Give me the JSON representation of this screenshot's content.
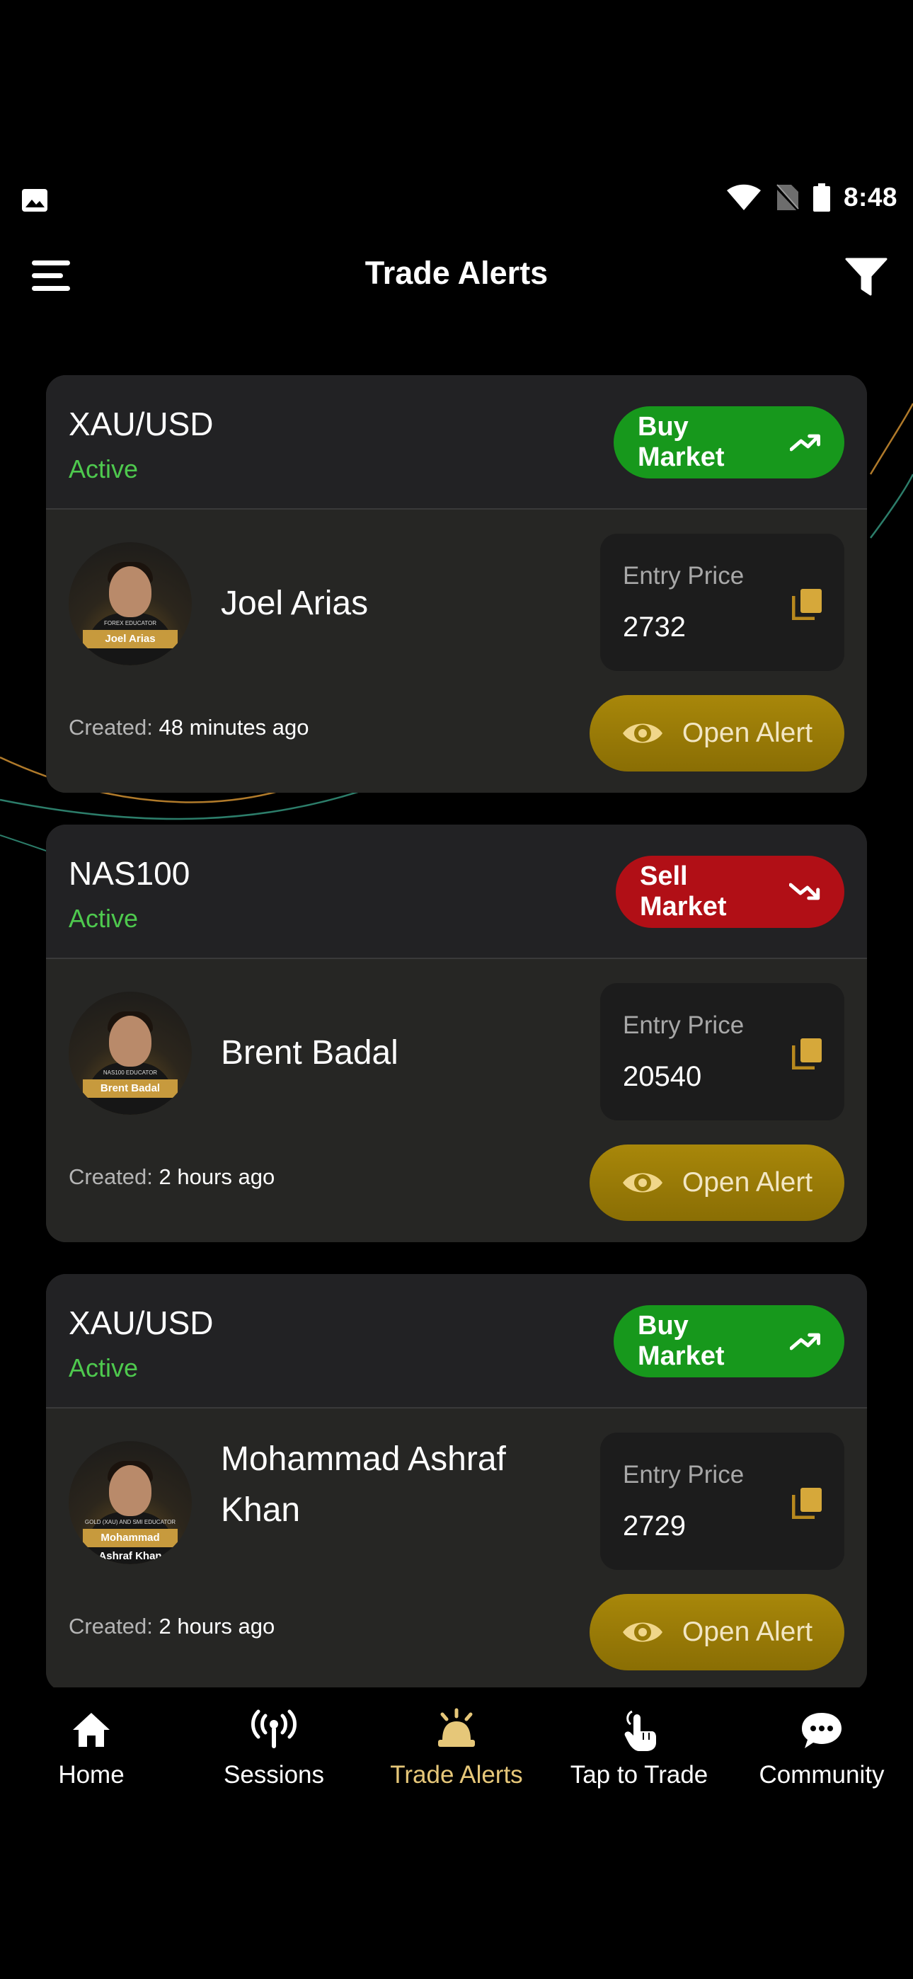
{
  "status_bar": {
    "time": "8:48",
    "left_icon": "image-icon",
    "right_icons": [
      "wifi-icon",
      "no-sim-icon",
      "battery-icon"
    ]
  },
  "header": {
    "title": "Trade Alerts",
    "menu_icon": "hamburger-menu-icon",
    "filter_icon": "filter-icon"
  },
  "colors": {
    "buy": "#17981c",
    "sell": "#b10f16",
    "active": "#4ec94e",
    "gold": "#a8870a",
    "nav_active": "#e6c779"
  },
  "alerts": [
    {
      "pair": "XAU/USD",
      "status": "Active",
      "action": "Buy Market",
      "action_type": "buy",
      "trader": "Joel Arias",
      "avatar_caption": "FOREX EDUCATOR",
      "avatar_name": "Joel Arias",
      "entry_label": "Entry Price",
      "entry_price": "2732",
      "created_label": "Created:",
      "created_value": "48 minutes ago",
      "open_label": "Open Alert"
    },
    {
      "pair": "NAS100",
      "status": "Active",
      "action": "Sell Market",
      "action_type": "sell",
      "trader": "Brent Badal",
      "avatar_caption": "NAS100 EDUCATOR",
      "avatar_name": "Brent Badal",
      "entry_label": "Entry Price",
      "entry_price": "20540",
      "created_label": "Created:",
      "created_value": "2 hours ago",
      "open_label": "Open Alert"
    },
    {
      "pair": "XAU/USD",
      "status": "Active",
      "action": "Buy Market",
      "action_type": "buy",
      "trader": "Mohammad Ashraf Khan",
      "avatar_caption": "GOLD (XAU) AND SMI EDUCATOR",
      "avatar_name": "Mohammad Ashraf Khan",
      "entry_label": "Entry Price",
      "entry_price": "2729",
      "created_label": "Created:",
      "created_value": "2 hours ago",
      "open_label": "Open Alert"
    }
  ],
  "bottom_nav": [
    {
      "label": "Home",
      "icon": "home-icon",
      "active": false
    },
    {
      "label": "Sessions",
      "icon": "broadcast-icon",
      "active": false
    },
    {
      "label": "Trade Alerts",
      "icon": "alarm-bell-icon",
      "active": true
    },
    {
      "label": "Tap to Trade",
      "icon": "tap-hand-icon",
      "active": false
    },
    {
      "label": "Community",
      "icon": "chat-bubble-icon",
      "active": false
    }
  ]
}
